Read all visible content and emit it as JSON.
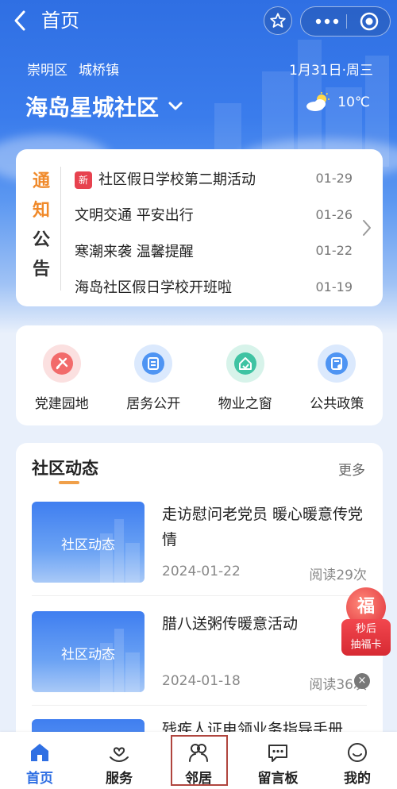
{
  "nav": {
    "title": "首页",
    "back_icon": "chevron-left-icon",
    "star_icon": "star-icon",
    "more_icon": "more-dots-icon",
    "close_icon": "target-circle-icon"
  },
  "location": {
    "district": "崇明区",
    "town": "城桥镇",
    "date": "1月31日·周三"
  },
  "community": {
    "name": "海岛星城社区",
    "dropdown_icon": "chevron-down-icon"
  },
  "weather": {
    "temp": "10℃",
    "icon": "partly-sunny-icon"
  },
  "notice": {
    "label": [
      "通",
      "知",
      "公",
      "告"
    ],
    "items": [
      {
        "badge": "新",
        "title": "社区假日学校第二期活动",
        "date": "01-29"
      },
      {
        "badge": "",
        "title": "文明交通 平安出行",
        "date": "01-26"
      },
      {
        "badge": "",
        "title": "寒潮来袭 温馨提醒",
        "date": "01-22"
      },
      {
        "badge": "",
        "title": "海岛社区假日学校开班啦",
        "date": "01-19"
      }
    ]
  },
  "quick": [
    {
      "label": "党建园地",
      "icon": "party-emblem-icon",
      "color": "#f26b6b"
    },
    {
      "label": "居务公开",
      "icon": "document-icon",
      "color": "#4e94f3"
    },
    {
      "label": "物业之窗",
      "icon": "house-icon",
      "color": "#3fc3a3"
    },
    {
      "label": "公共政策",
      "icon": "policy-file-icon",
      "color": "#4e94f3"
    }
  ],
  "news": {
    "title": "社区动态",
    "more": "更多",
    "articles": [
      {
        "thumb_label": "社区动态",
        "title": "走访慰问老党员 暖心暖意传党情",
        "date": "2024-01-22",
        "reads": "阅读29次"
      },
      {
        "thumb_label": "社区动态",
        "title": "腊八送粥传暖意活动",
        "date": "2024-01-18",
        "reads": "阅读36次"
      },
      {
        "thumb_label": "",
        "title": "残疾人证电领业务指导手册",
        "date": "",
        "reads": ""
      }
    ]
  },
  "lucky": {
    "char": "福",
    "line1": "秒后",
    "line2": "抽福卡",
    "close": "×"
  },
  "tabs": [
    {
      "label": "首页",
      "icon": "home-icon",
      "active": true
    },
    {
      "label": "服务",
      "icon": "heart-hand-icon",
      "active": false
    },
    {
      "label": "邻居",
      "icon": "neighbors-icon",
      "active": false
    },
    {
      "label": "留言板",
      "icon": "message-board-icon",
      "active": false
    },
    {
      "label": "我的",
      "icon": "profile-smile-icon",
      "active": false
    }
  ],
  "colors": {
    "primary": "#2f6fe3",
    "accent": "#f08a2b",
    "badge": "#e7424f"
  }
}
